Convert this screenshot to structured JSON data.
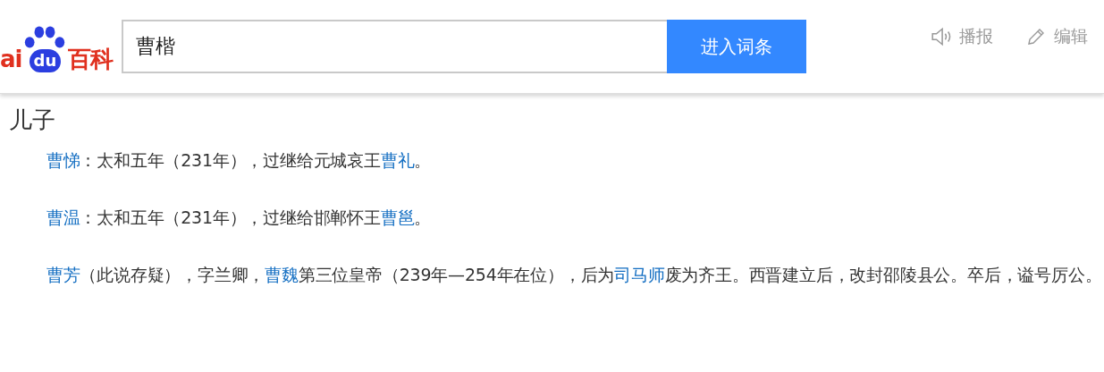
{
  "logo": {
    "left": "ai",
    "pad": "du",
    "right": "百科"
  },
  "search": {
    "value": "曹楷",
    "button": "进入词条"
  },
  "actions": [
    {
      "kind": "speaker",
      "label": "播报"
    },
    {
      "kind": "edit",
      "label": "编辑"
    }
  ],
  "section": {
    "heading": "儿子",
    "paragraphs": [
      {
        "segments": [
          {
            "text": "曹悌",
            "link": true
          },
          {
            "text": "：太和五年（231年），过继给元城哀王",
            "link": false
          },
          {
            "text": "曹礼",
            "link": true
          },
          {
            "text": "。",
            "link": false
          }
        ]
      },
      {
        "segments": [
          {
            "text": "曹温",
            "link": true
          },
          {
            "text": "：太和五年（231年），过继给邯郸怀王",
            "link": false
          },
          {
            "text": "曹邕",
            "link": true
          },
          {
            "text": "。",
            "link": false
          }
        ]
      },
      {
        "segments": [
          {
            "text": "曹芳",
            "link": true
          },
          {
            "text": "（此说存疑），字兰卿，",
            "link": false
          },
          {
            "text": "曹魏",
            "link": true
          },
          {
            "text": "第三位皇帝（239年—254年在位），后为",
            "link": false
          },
          {
            "text": "司马师",
            "link": true
          },
          {
            "text": "废为齐王。西晋建立后，改封邵陵县公。卒后，谥号厉公。",
            "link": false
          }
        ]
      }
    ]
  }
}
